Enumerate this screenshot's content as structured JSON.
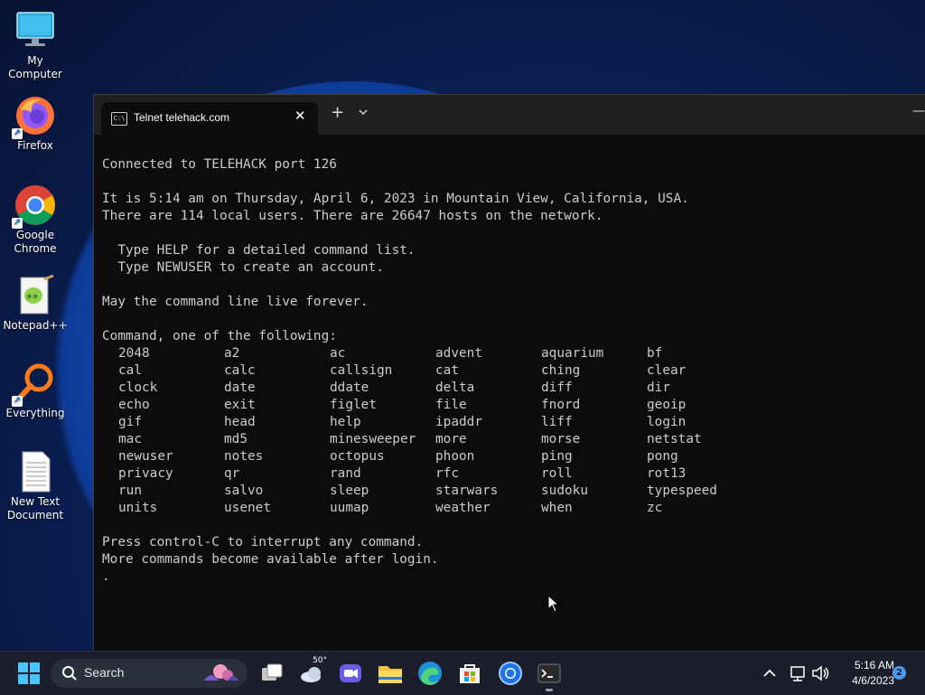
{
  "desktop": {
    "icons": [
      {
        "name": "My Computer",
        "icon": "monitor-icon"
      },
      {
        "name": "Firefox",
        "icon": "firefox-icon"
      },
      {
        "name": "Google Chrome",
        "icon": "chrome-icon"
      },
      {
        "name": "Notepad++",
        "icon": "notepad-plus-plus-icon"
      },
      {
        "name": "Everything",
        "icon": "everything-search-icon"
      },
      {
        "name": "New Text Document",
        "icon": "text-document-icon"
      }
    ]
  },
  "window": {
    "tab_title": "Telnet telehack.com",
    "new_tab": "+",
    "dropdown": "⌄",
    "minimize": "—"
  },
  "terminal": {
    "lines": [
      "Connected to TELEHACK port 126",
      "",
      "It is 5:14 am on Thursday, April 6, 2023 in Mountain View, California, USA.",
      "There are 114 local users. There are 26647 hosts on the network.",
      "",
      "  Type HELP for a detailed command list.",
      "  Type NEWUSER to create an account.",
      "",
      "May the command line live forever.",
      "",
      "Command, one of the following:"
    ],
    "commands": [
      "2048",
      "a2",
      "ac",
      "advent",
      "aquarium",
      "bf",
      "cal",
      "calc",
      "callsign",
      "cat",
      "ching",
      "clear",
      "clock",
      "date",
      "ddate",
      "delta",
      "diff",
      "dir",
      "echo",
      "exit",
      "figlet",
      "file",
      "fnord",
      "geoip",
      "gif",
      "head",
      "help",
      "ipaddr",
      "liff",
      "login",
      "mac",
      "md5",
      "minesweeper",
      "more",
      "morse",
      "netstat",
      "newuser",
      "notes",
      "octopus",
      "phoon",
      "ping",
      "pong",
      "privacy",
      "qr",
      "rand",
      "rfc",
      "roll",
      "rot13",
      "run",
      "salvo",
      "sleep",
      "starwars",
      "sudoku",
      "typespeed",
      "units",
      "usenet",
      "uumap",
      "weather",
      "when",
      "zc"
    ],
    "footer_lines": [
      "",
      "Press control-C to interrupt any command.",
      "More commands become available after login.",
      "."
    ]
  },
  "taskbar": {
    "search_label": "Search",
    "weather_temp": "50°",
    "pinned": [
      "start-icon",
      "task-view-icon",
      "weather-widget-icon",
      "meet-video-icon",
      "file-explorer-icon",
      "edge-icon",
      "store-icon",
      "chrome-icon",
      "terminal-icon"
    ],
    "clock_time": "5:16 AM",
    "clock_date": "4/6/2023",
    "notification_count": "2"
  }
}
